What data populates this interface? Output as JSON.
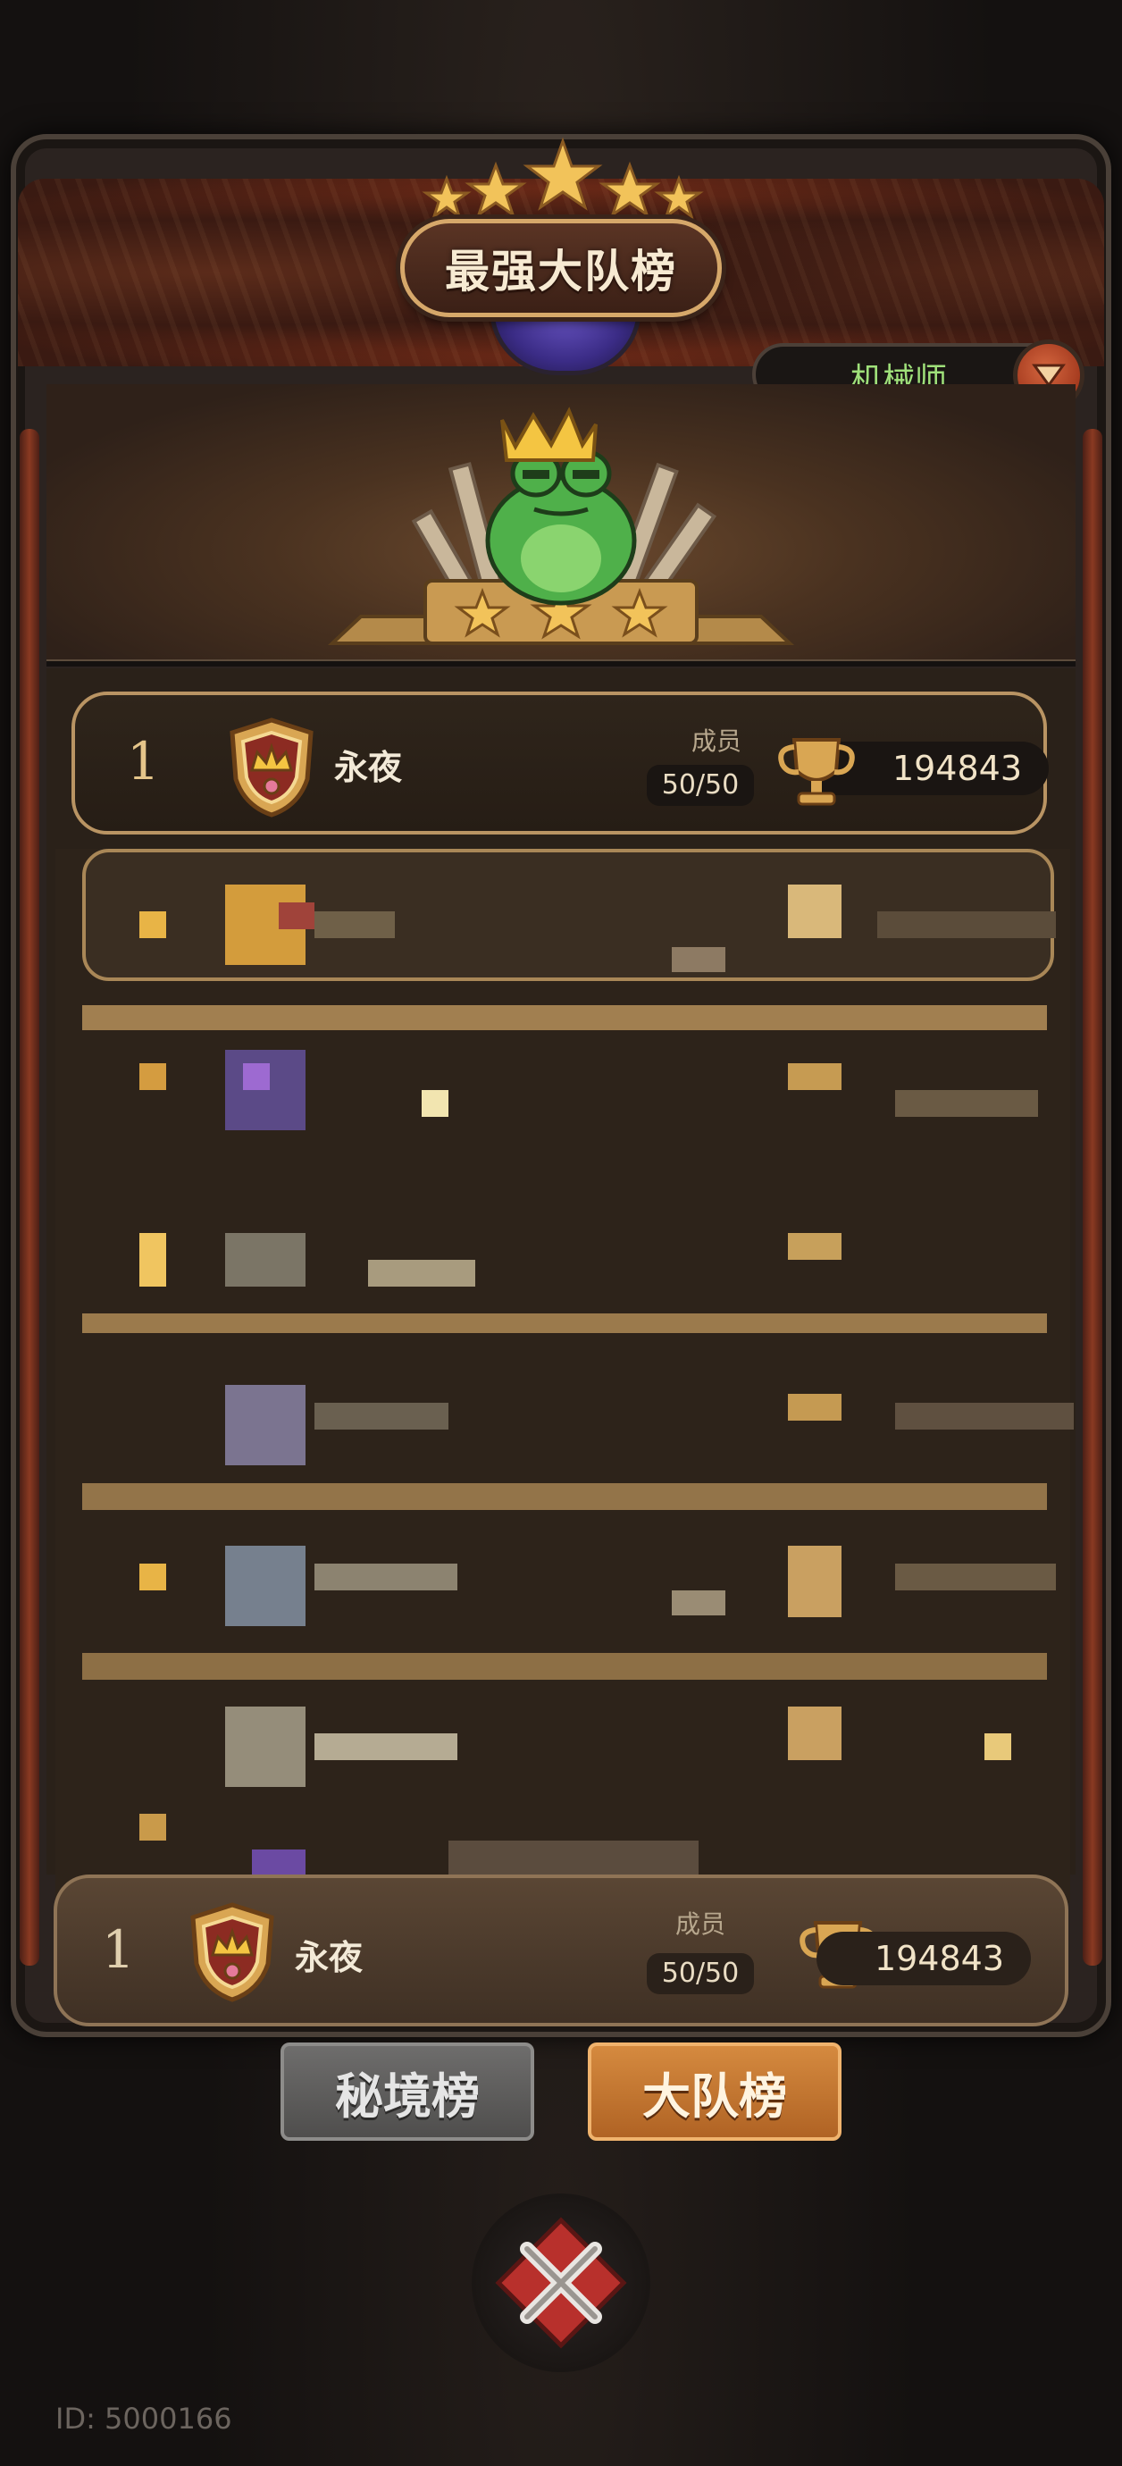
{
  "header": {
    "title": "最强大队榜",
    "class_selector": {
      "label": "机械师",
      "icon": "chevron-down-icon"
    }
  },
  "top_entry": {
    "rank": "1",
    "name": "永夜",
    "members_label": "成员",
    "members_value": "50/50",
    "score": "194843",
    "emblem_icon": "crown-shield-icon",
    "trophy_icon": "trophy-icon"
  },
  "my_entry": {
    "rank": "1",
    "name": "永夜",
    "members_label": "成员",
    "members_value": "50/50",
    "score": "194843"
  },
  "tabs": [
    {
      "label": "秘境榜",
      "active": false
    },
    {
      "label": "大队榜",
      "active": true
    }
  ],
  "footer": {
    "id_text": "ID: 5000166"
  },
  "colors": {
    "accent_gold": "#d6a86a",
    "class_green": "#9fe07a",
    "tab_active": "#c8752f",
    "tab_inactive": "#5e5d5c"
  }
}
